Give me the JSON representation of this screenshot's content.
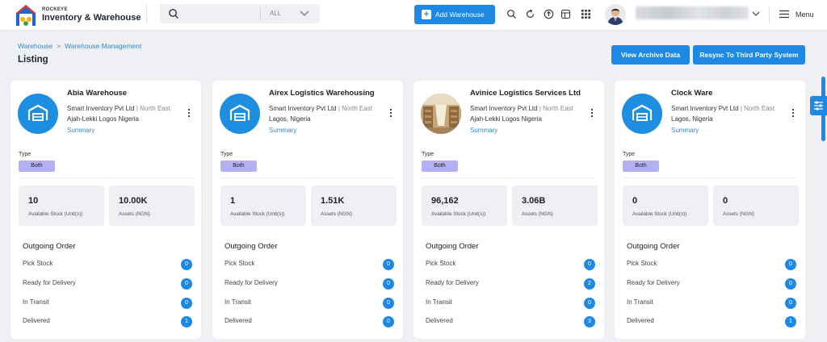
{
  "header": {
    "brand_small": "ROCKEYE",
    "brand_big": "Inventory & Warehouse",
    "search": {
      "scope": "ALL"
    },
    "add_button": "Add Warehouse",
    "menu_label": "Menu",
    "icons": [
      "search-icon",
      "refresh-icon",
      "upload-icon",
      "table-icon",
      "apps-grid-icon"
    ]
  },
  "breadcrumb": [
    "Warehouse",
    "Warehouse Management"
  ],
  "page_title": "Listing",
  "actions": {
    "archive": "View Archive Data",
    "resync": "Resync To Third Party System"
  },
  "colors": {
    "accent": "#1e88e5",
    "badge": "#b3b0f4",
    "card_bg": "#ffffff",
    "page_bg": "#eef0f4"
  },
  "type_label": "Type",
  "outgoing_title": "Outgoing Order",
  "order_labels": [
    "Pick Stock",
    "Ready for Delivery",
    "In Transit",
    "Delivered"
  ],
  "stat_labels": {
    "stock": "Available Stock (Unit(s))",
    "assets": "Assets (NGN)"
  },
  "summary_label": "Summary",
  "warehouses": [
    {
      "name": "Abia Warehouse",
      "company": "Smart Inventory Pvt Ltd",
      "region": "| North East",
      "address": "Ajah-Lekki Logos Nigeria",
      "type": "Both",
      "stock": "10",
      "assets": "10.00K",
      "counts": [
        "0",
        "0",
        "0",
        "1"
      ],
      "image": "icon"
    },
    {
      "name": "Airex Logistics Warehousing",
      "company": "Smart Inventory Pvt Ltd",
      "region": "| North East",
      "address": "Lagos, Nigeria",
      "type": "Both",
      "stock": "1",
      "assets": "1.51K",
      "counts": [
        "0",
        "0",
        "0",
        "0"
      ],
      "image": "icon"
    },
    {
      "name": "Avinice Logistics Services Ltd",
      "company": "Smart Inventory Pvt Ltd",
      "region": "| North East",
      "address": "Ajah-Lekki Logos Nigeria",
      "type": "Both",
      "stock": "96,162",
      "assets": "3.06B",
      "counts": [
        "0",
        "2",
        "0",
        "3"
      ],
      "image": "photo"
    },
    {
      "name": "Clock Ware",
      "company": "Smart Inventory Pvt Ltd",
      "region": "| North East",
      "address": "Lagos, Nigeria",
      "type": "Both",
      "stock": "0",
      "assets": "0",
      "counts": [
        "0",
        "0",
        "0",
        "1"
      ],
      "image": "icon"
    }
  ]
}
